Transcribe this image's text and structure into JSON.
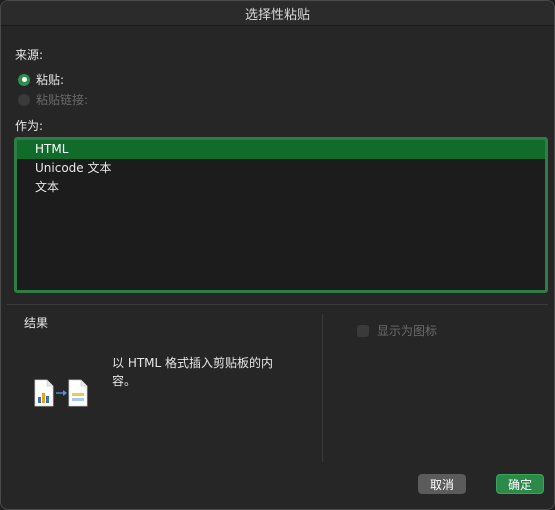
{
  "dialog": {
    "title": "选择性粘贴"
  },
  "source": {
    "label": "来源:",
    "options": [
      {
        "label": "粘贴:",
        "selected": true,
        "enabled": true
      },
      {
        "label": "粘贴链接:",
        "selected": false,
        "enabled": false
      }
    ]
  },
  "as": {
    "label": "作为:",
    "items": [
      {
        "label": "HTML",
        "selected": true
      },
      {
        "label": "Unicode 文本",
        "selected": false
      },
      {
        "label": "文本",
        "selected": false
      }
    ]
  },
  "result": {
    "label": "结果",
    "description": "以 HTML 格式插入剪贴板的内容。"
  },
  "display_as_icon": {
    "label": "显示为图标",
    "checked": false,
    "enabled": false
  },
  "buttons": {
    "cancel": "取消",
    "ok": "确定"
  },
  "colors": {
    "accent": "#2b8a47",
    "selection": "#116b2a",
    "list_border": "#2e7d46"
  }
}
